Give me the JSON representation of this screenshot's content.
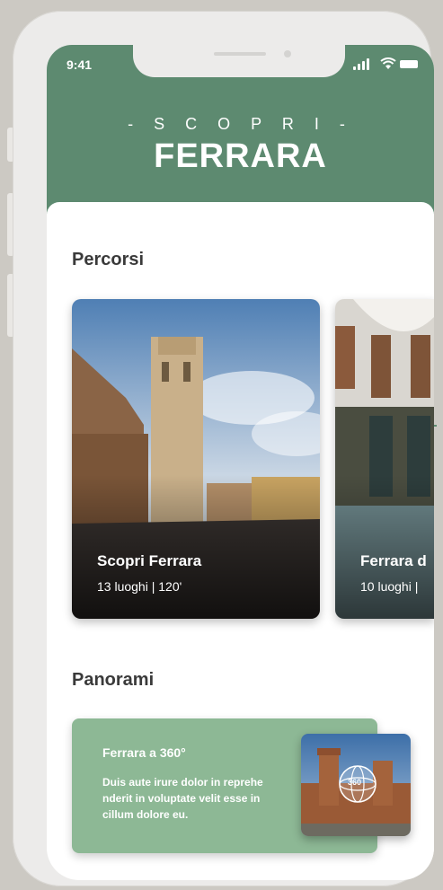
{
  "status_bar": {
    "time": "9:41"
  },
  "header": {
    "kicker": "- S C O P R I -",
    "title": "FERRARA"
  },
  "routes": {
    "section_title": "Percorsi",
    "items": [
      {
        "name": "Scopri Ferrara",
        "meta": "13 luoghi | 120'"
      },
      {
        "name": "Ferrara d",
        "meta": "10 luoghi |"
      }
    ]
  },
  "panoramas": {
    "section_title": "Panorami",
    "items": [
      {
        "title": "Ferrara a 360°",
        "description": "Duis aute irure dolor in reprehe nderit in voluptate velit esse in cillum dolore eu.",
        "badge": "360"
      }
    ]
  },
  "colors": {
    "brand_green": "#5d8a70",
    "card_green": "#8db895",
    "background": "#ccc9c3"
  }
}
